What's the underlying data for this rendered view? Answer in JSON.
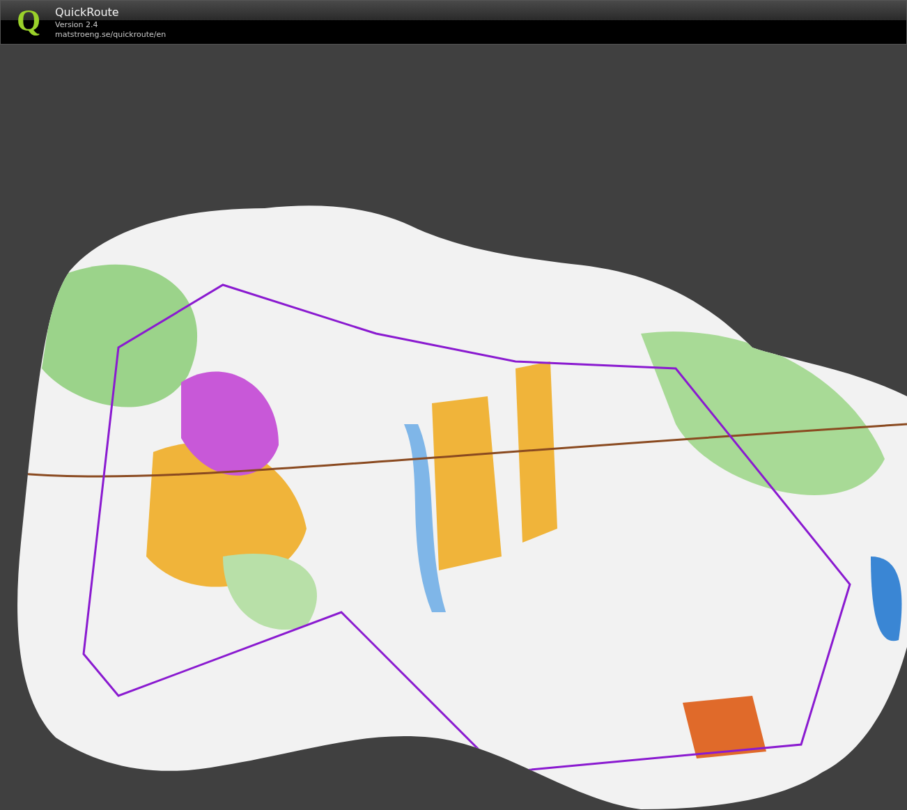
{
  "header": {
    "logo_letter": "Q",
    "app_name": "QuickRoute",
    "version": "Version 2.4",
    "url": "matstroeng.se/quickroute/en"
  }
}
